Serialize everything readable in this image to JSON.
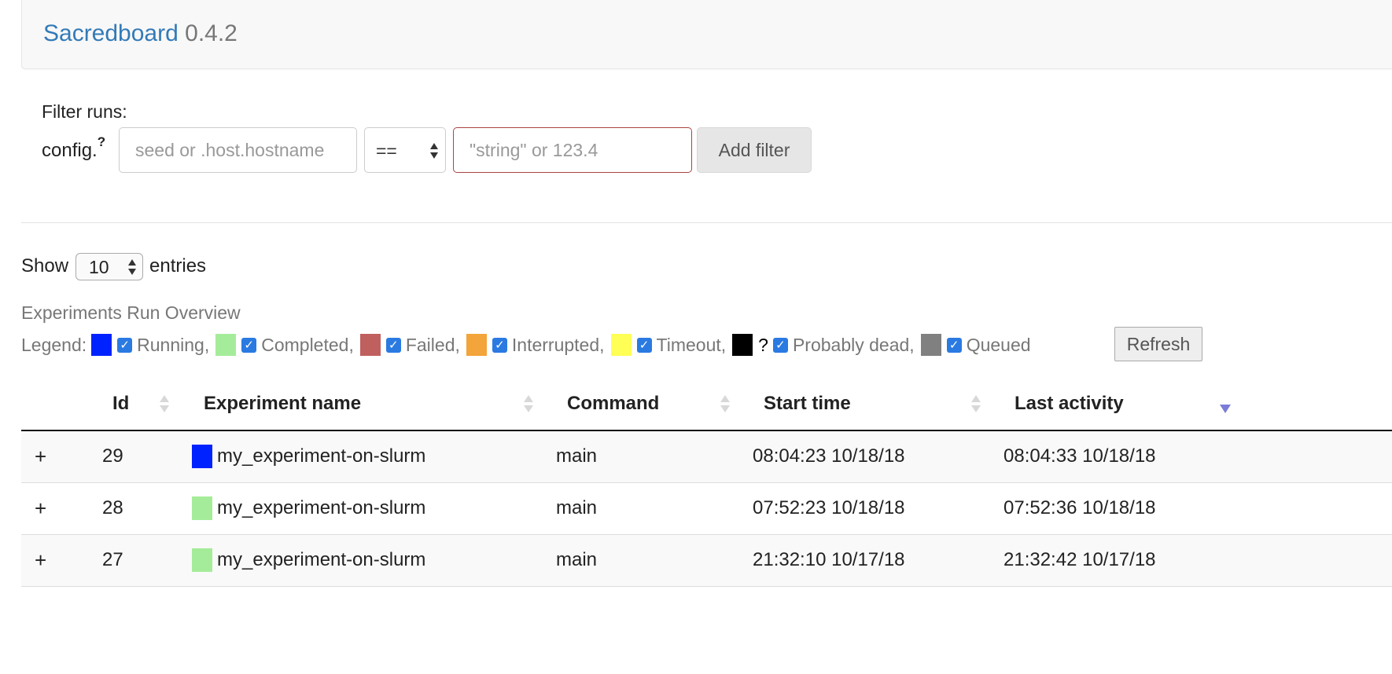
{
  "app": {
    "brand_name": "Sacredboard",
    "version": "0.4.2"
  },
  "filter": {
    "title": "Filter runs:",
    "prefix_label": "config.",
    "help_marker": "?",
    "key_placeholder": "seed or .host.hostname",
    "key_value": "",
    "operator": "==",
    "value_placeholder": "\"string\" or 123.4",
    "value_value": "",
    "add_label": "Add filter"
  },
  "paging": {
    "show_label": "Show",
    "entries_value": "10",
    "entries_label": "entries"
  },
  "overview": {
    "title": "Experiments Run Overview",
    "legend_title": "Legend:",
    "legend": [
      {
        "label": "Running,",
        "color": "#0022ff",
        "checked": true
      },
      {
        "label": "Completed,",
        "color": "#a5ec9a",
        "checked": true
      },
      {
        "label": "Failed,",
        "color": "#c0605e",
        "checked": true
      },
      {
        "label": "Interrupted,",
        "color": "#f3a43a",
        "checked": true
      },
      {
        "label": "Timeout,",
        "color": "#ffff55",
        "checked": true
      },
      {
        "label": "Probably dead,",
        "color": "#000000",
        "marker": "?",
        "checked": true
      },
      {
        "label": "Queued",
        "color": "#808080",
        "checked": true
      }
    ],
    "refresh_label": "Refresh"
  },
  "table": {
    "columns": {
      "id": "Id",
      "name": "Experiment name",
      "command": "Command",
      "start": "Start time",
      "last": "Last activity"
    },
    "rows": [
      {
        "expand": "+",
        "id": "29",
        "status_color": "#0022ff",
        "name": "my_experiment-on-slurm",
        "command": "main",
        "start": "08:04:23 10/18/18",
        "last": "08:04:33 10/18/18"
      },
      {
        "expand": "+",
        "id": "28",
        "status_color": "#a5ec9a",
        "name": "my_experiment-on-slurm",
        "command": "main",
        "start": "07:52:23 10/18/18",
        "last": "07:52:36 10/18/18"
      },
      {
        "expand": "+",
        "id": "27",
        "status_color": "#a5ec9a",
        "name": "my_experiment-on-slurm",
        "command": "main",
        "start": "21:32:10 10/17/18",
        "last": "21:32:42 10/17/18"
      }
    ]
  }
}
